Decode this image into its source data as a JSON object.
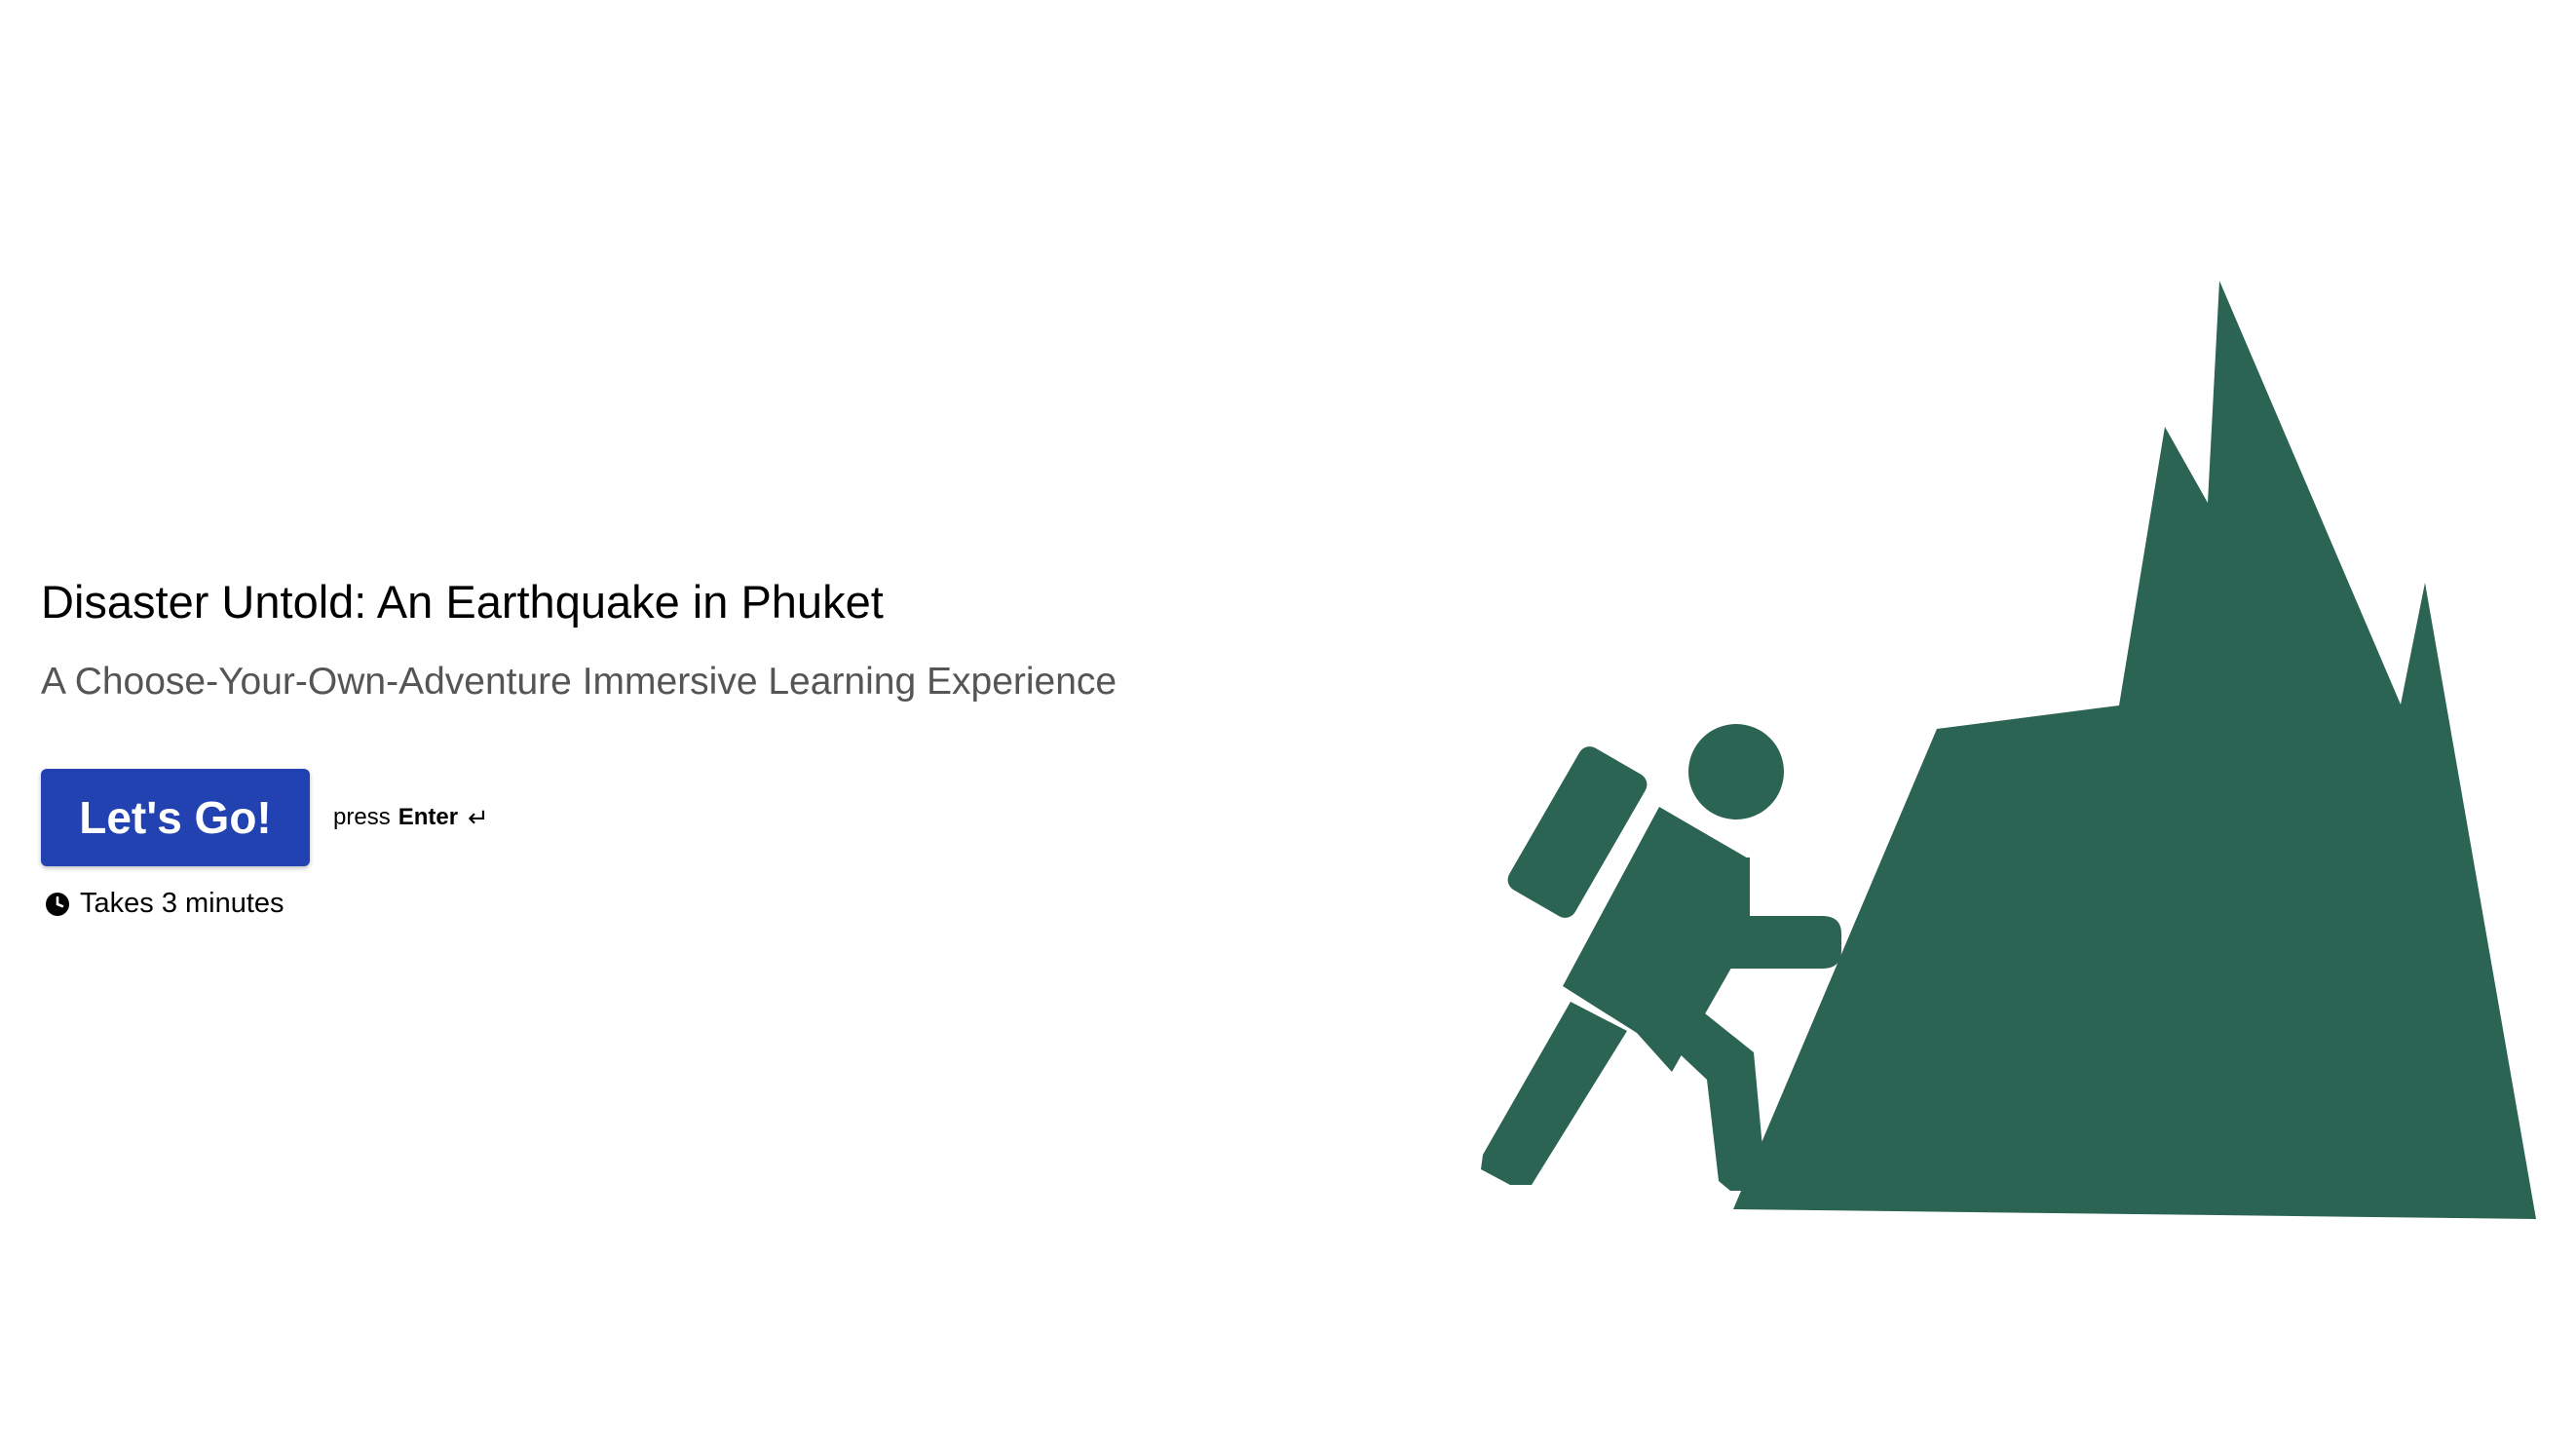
{
  "hero": {
    "title": "Disaster Untold: An Earthquake in Phuket",
    "subtitle": "A Choose-Your-Own-Adventure Immersive Learning Experience"
  },
  "cta": {
    "button_label": "Let's Go!",
    "press_label": "press",
    "key_label": "Enter",
    "enter_icon": "return-arrow-icon"
  },
  "duration": {
    "icon": "clock-icon",
    "label": "Takes 3 minutes"
  },
  "illustration": {
    "icon": "hiker-climbing-mountain-icon",
    "color": "#2b6453"
  },
  "colors": {
    "accent": "#2142b0",
    "subtitle": "#555555",
    "illustration": "#2b6453"
  }
}
